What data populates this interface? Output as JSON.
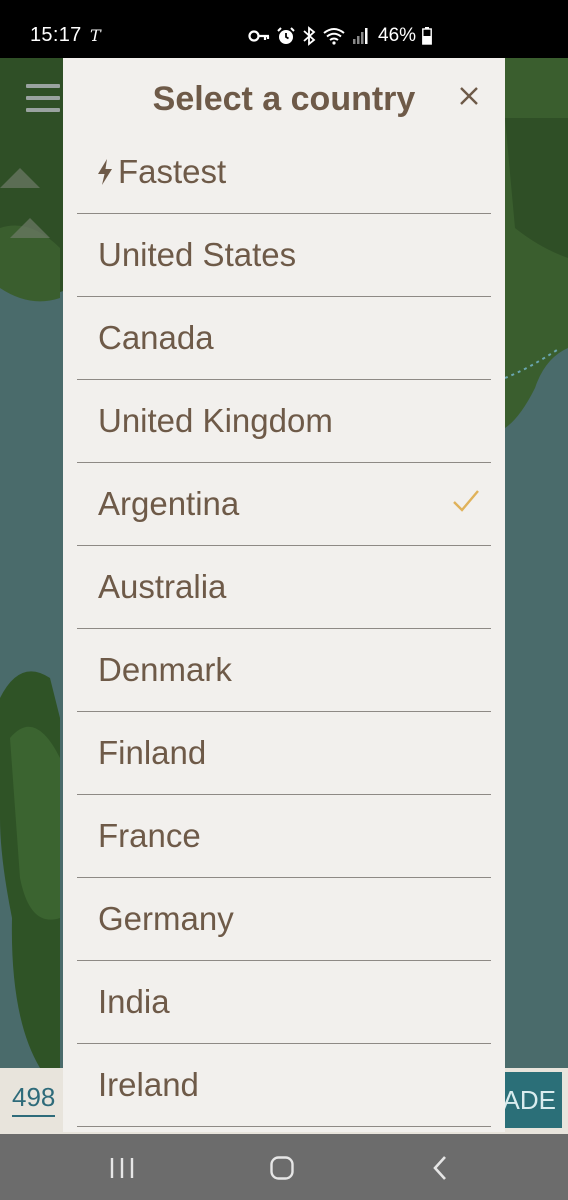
{
  "status_bar": {
    "time": "15:17",
    "carrier_icon": "T",
    "battery": "46%"
  },
  "background": {
    "data_count": "498",
    "upgrade_label": "ADE"
  },
  "dialog": {
    "title": "Select a country",
    "close_icon": "close-icon",
    "fastest": {
      "label": "Fastest",
      "icon": "bolt-icon"
    },
    "countries": [
      {
        "label": "United States",
        "selected": false
      },
      {
        "label": "Canada",
        "selected": false
      },
      {
        "label": "United Kingdom",
        "selected": false
      },
      {
        "label": "Argentina",
        "selected": true
      },
      {
        "label": "Australia",
        "selected": false
      },
      {
        "label": "Denmark",
        "selected": false
      },
      {
        "label": "Finland",
        "selected": false
      },
      {
        "label": "France",
        "selected": false
      },
      {
        "label": "Germany",
        "selected": false
      },
      {
        "label": "India",
        "selected": false
      },
      {
        "label": "Ireland",
        "selected": false
      }
    ]
  },
  "colors": {
    "dialog_bg": "#f2f0ed",
    "text": "#6e5a48",
    "check": "#e0b25a",
    "divider": "#8e8a85",
    "nav_bar": "#6c6c6c"
  },
  "nav_bar": {
    "recents_icon": "recents-icon",
    "home_icon": "home-icon",
    "back_icon": "back-icon"
  }
}
